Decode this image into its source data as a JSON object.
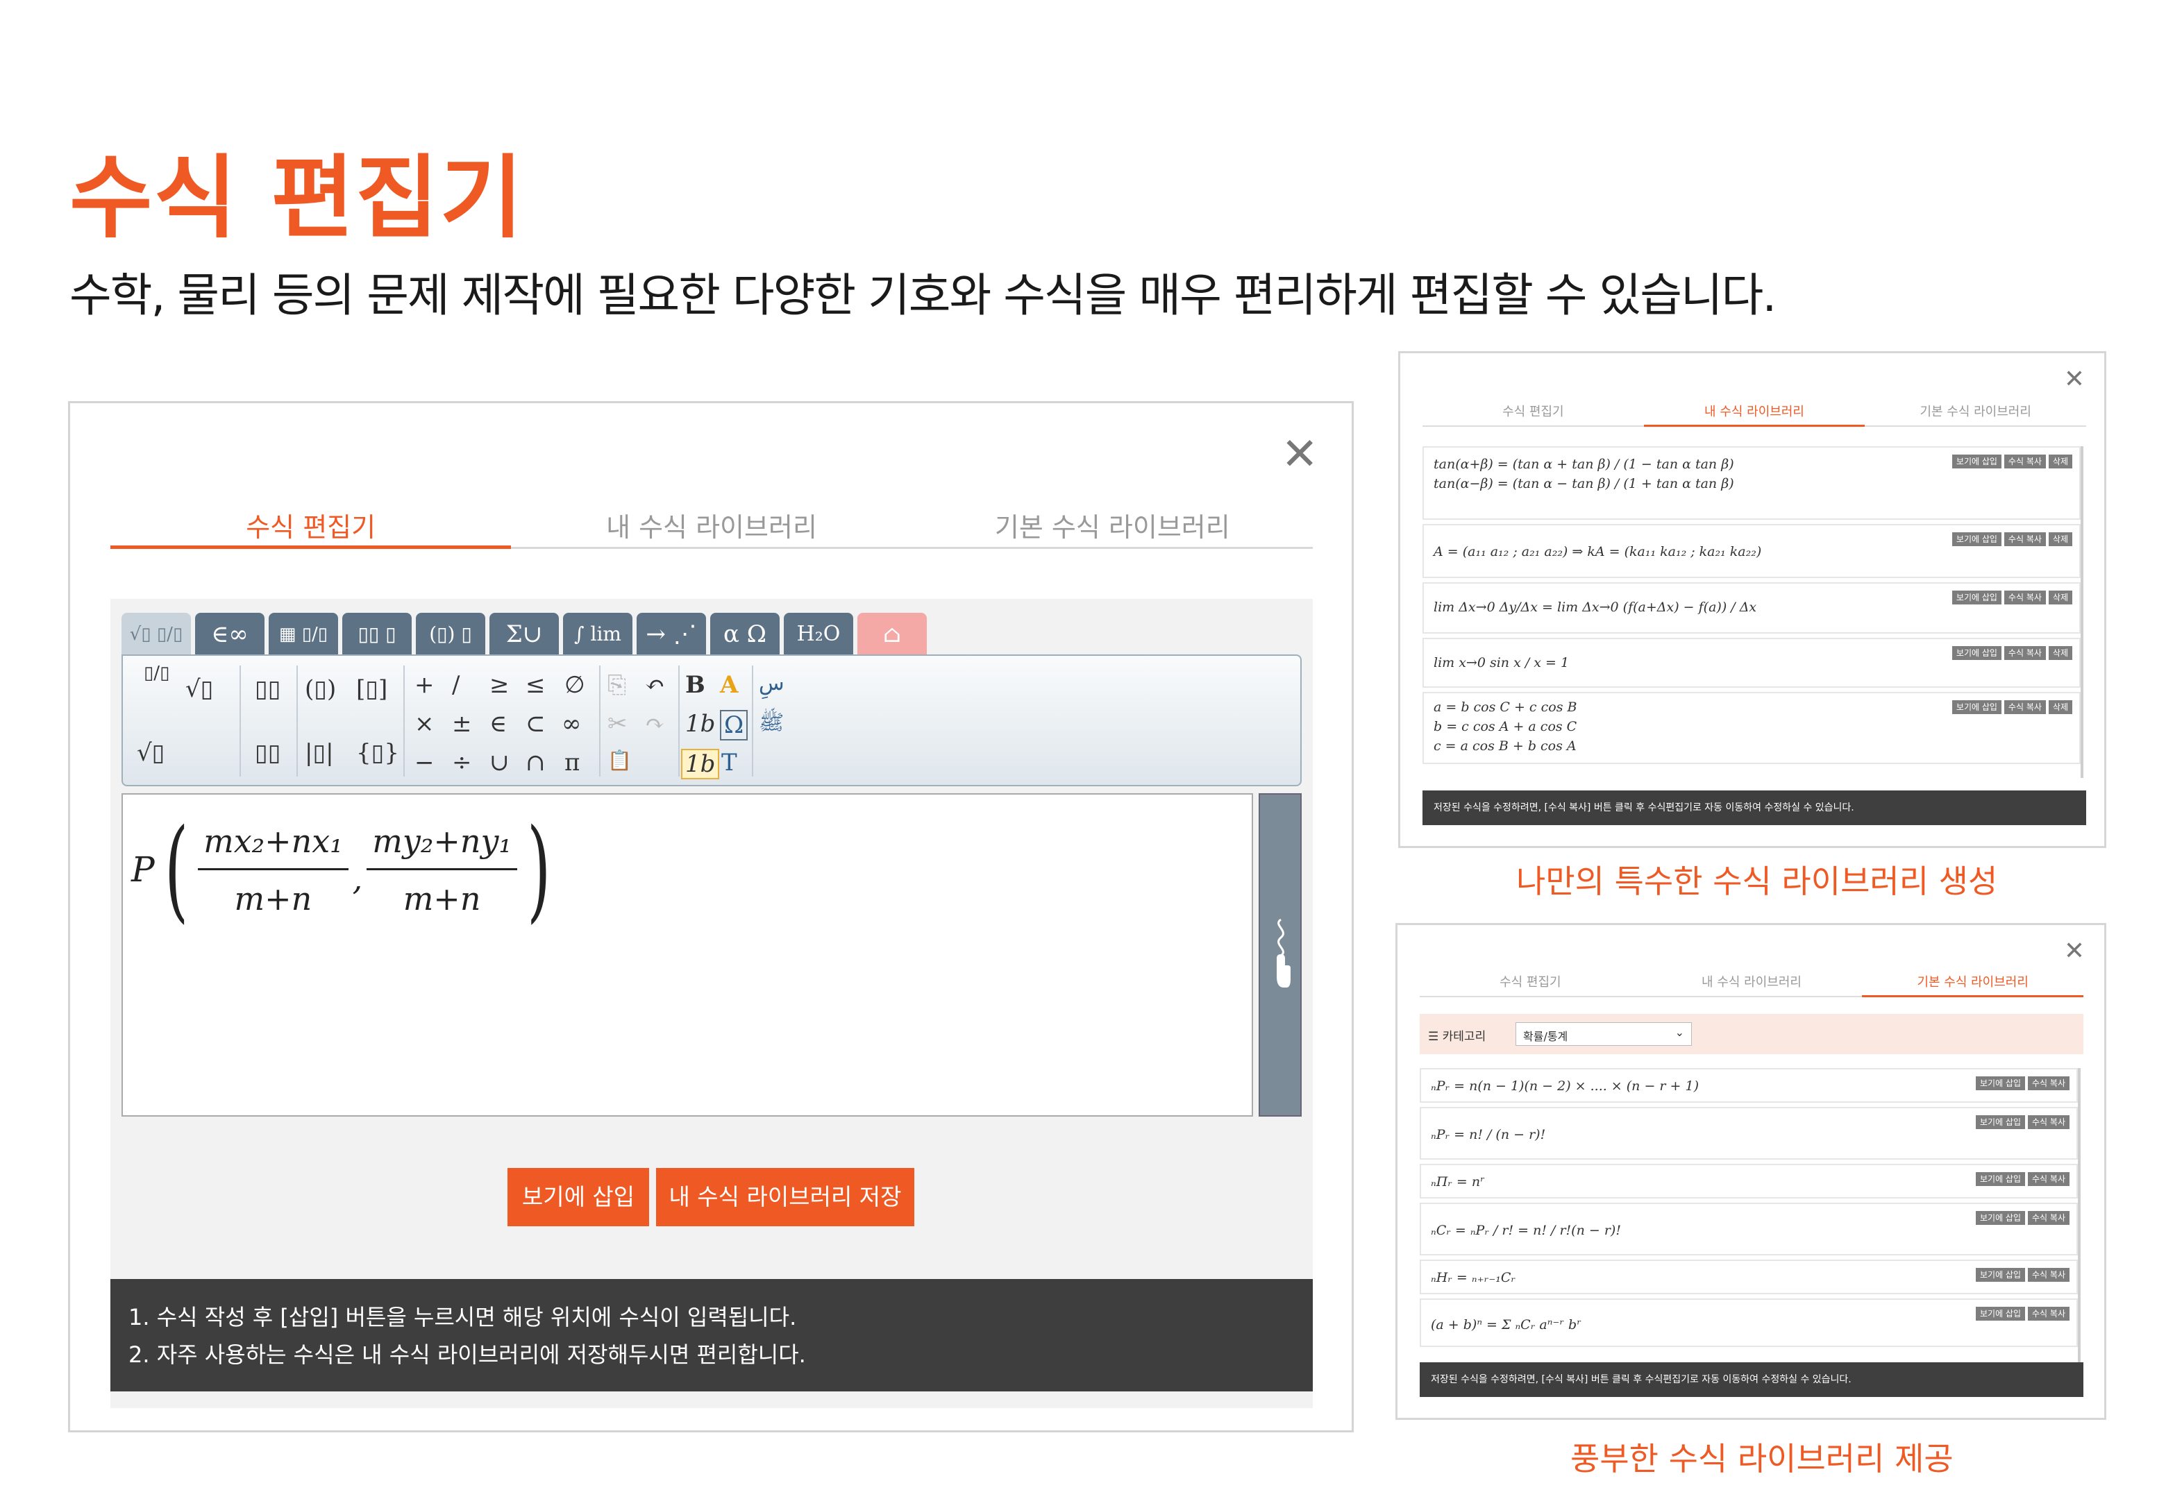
{
  "header": {
    "title": "수식 편집기",
    "subtitle": "수학, 물리 등의 문제 제작에 필요한 다양한 기호와 수식을 매우 편리하게 편집할 수 있습니다."
  },
  "editor_panel": {
    "close": "✕",
    "tabs": [
      "수식 편집기",
      "내 수식 라이브러리",
      "기본 수식 라이브러리"
    ],
    "tool_tabs": [
      "√▯ ▯/▯",
      "∈∞",
      "▦ ▯/▯",
      "▯▯ ▯",
      "(▯) ▯",
      "Σ∪",
      "∫ lim",
      "→ ⋰",
      "α Ω",
      "H₂O",
      "⌂"
    ],
    "tools": [
      "▯/▯",
      "√▯",
      "√▯",
      "▯▯",
      "▯▯",
      "(▯)",
      "[▯]",
      "|▯|",
      "{▯}",
      "+",
      "/",
      "≥",
      "≤",
      "∅",
      "×",
      "±",
      "∈",
      "⊂",
      "∞",
      "−",
      "÷",
      "∪",
      "∩",
      "π",
      "⎘",
      "↶",
      "✂",
      "↷",
      "📋",
      "B",
      "A",
      "1b",
      "Ω",
      "1b",
      "T",
      "سِ",
      "ﷺ"
    ],
    "formula": {
      "lhs": "P",
      "num1": "mx₂+nx₁",
      "den1": "m+n",
      "comma": ",",
      "num2": "my₂+ny₁",
      "den2": "m+n"
    },
    "buttons": {
      "insert": "보기에 삽입",
      "save": "내 수식 라이브러리 저장"
    },
    "notice": [
      "1. 수식 작성 후 [삽입] 버튼을 누르시면 해당 위치에 수식이 입력됩니다.",
      "2. 자주 사용하는 수식은 내 수식 라이브러리에 저장해두시면 편리합니다."
    ]
  },
  "my_library_panel": {
    "close": "✕",
    "tabs": [
      "수식 편집기",
      "내 수식 라이브러리",
      "기본 수식 라이브러리"
    ],
    "row_buttons": [
      "보기에 삽입",
      "수식 복사",
      "삭제"
    ],
    "rows": [
      [
        "tan(α+β) = (tan α + tan β) / (1 − tan α tan β)",
        "tan(α−β) = (tan α − tan β) / (1 + tan α tan β)"
      ],
      [
        "A = (a₁₁ a₁₂ ; a₂₁ a₂₂)   ⇒   kA = (ka₁₁ ka₁₂ ; ka₂₁ ka₂₂)"
      ],
      [
        "lim Δx→0 Δy/Δx = lim Δx→0 (f(a+Δx) − f(a)) / Δx"
      ],
      [
        "lim x→0 sin x / x = 1"
      ],
      [
        "a = b cos C + c cos B",
        "b = c cos A + a cos C",
        "c = a cos B + b cos A"
      ]
    ],
    "footer": "저장된 수식을 수정하려면, [수식 복사] 버튼 클릭 후 수식편집기로 자동 이동하여 수정하실 수 있습니다.",
    "caption": "나만의 특수한 수식 라이브러리 생성"
  },
  "basic_library_panel": {
    "close": "✕",
    "tabs": [
      "수식 편집기",
      "내 수식 라이브러리",
      "기본 수식 라이브러리"
    ],
    "category_label": "☰ 카테고리",
    "category_value": "확률/통계",
    "row_buttons": [
      "보기에 삽입",
      "수식 복사"
    ],
    "rows": [
      "ₙPᵣ = n(n − 1)(n − 2) × .... × (n − r + 1)",
      "ₙPᵣ = n! / (n − r)!",
      "ₙΠᵣ = nʳ",
      "ₙCᵣ = ₙPᵣ / r! = n! / r!(n − r)!",
      "ₙHᵣ = ₙ₊ᵣ₋₁Cᵣ",
      "(a + b)ⁿ = Σ ₙCᵣ aⁿ⁻ʳ bʳ"
    ],
    "footer": "저장된 수식을 수정하려면, [수식 복사] 버튼 클릭 후 수식편집기로 자동 이동하여 수정하실 수 있습니다.",
    "caption": "풍부한 수식 라이브러리 제공"
  },
  "colors": {
    "accent": "#ef5a24",
    "toolbar_tab": "#5e7286",
    "notice_bg": "#3e3e3e"
  }
}
